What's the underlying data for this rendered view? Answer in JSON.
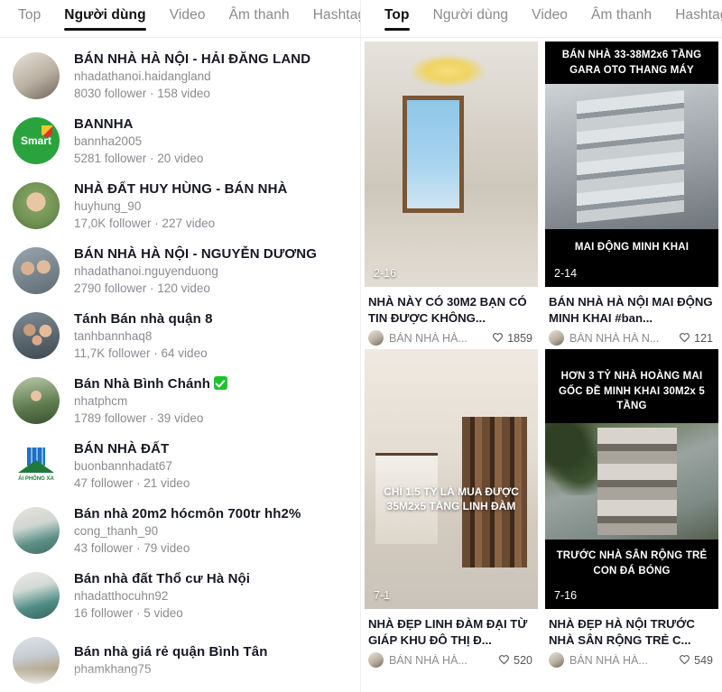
{
  "left_panel": {
    "tabs": [
      {
        "label": "Top",
        "active": false
      },
      {
        "label": "Người dùng",
        "active": true
      },
      {
        "label": "Video",
        "active": false
      },
      {
        "label": "Âm thanh",
        "active": false
      },
      {
        "label": "Hashtag",
        "active": false
      }
    ],
    "users": [
      {
        "name": "BÁN NHÀ HÀ NỘI - HẢI ĐĂNG LAND",
        "handle": "nhadathanoi.haidangland",
        "stats": "8030 follower · 158 video",
        "verified": false,
        "avatar": "room-interior-photo"
      },
      {
        "name": "BANNHA",
        "handle": "bannha2005",
        "stats": "5281 follower · 20 video",
        "verified": false,
        "avatar": "smart-green-logo"
      },
      {
        "name": "NHÀ ĐẤT HUY HÙNG - BÁN NHÀ",
        "handle": "huyhung_90",
        "stats": "17,0K follower · 227 video",
        "verified": false,
        "avatar": "man-with-cap-photo"
      },
      {
        "name": "BÁN NHÀ HÀ NỘI - NGUYỄN DƯƠNG",
        "handle": "nhadathanoi.nguyenduong",
        "stats": "2790 follower · 120 video",
        "verified": false,
        "avatar": "person-indoor-photo"
      },
      {
        "name": "Tánh Bán nhà quận 8",
        "handle": "tanhbannhaq8",
        "stats": "11,7K follower · 64 video",
        "verified": false,
        "avatar": "family-photo"
      },
      {
        "name": "Bán Nhà Bình Chánh",
        "handle": "nhatphcm",
        "stats": "1789 follower · 39 video",
        "verified": true,
        "avatar": "woman-outdoor-photo"
      },
      {
        "name": "BÁN NHÀ ĐẤT",
        "handle": "buonbannhadat67",
        "stats": "47 follower · 21 video",
        "verified": false,
        "avatar": "real-estate-logo"
      },
      {
        "name": "Bán nhà 20m2 hócmôn 700tr hh2%",
        "handle": "cong_thanh_90",
        "stats": "43 follower · 79 video",
        "verified": false,
        "avatar": "kitchen-photo"
      },
      {
        "name": "Bán nhà đất Thổ cư Hà Nội",
        "handle": "nhadatthocuhn92",
        "stats": "16 follower · 5 video",
        "verified": false,
        "avatar": "kitchen-green-photo"
      },
      {
        "name": "Bán nhà giá rẻ quận Bình Tân",
        "handle": "phamkhang75",
        "stats": "",
        "verified": false,
        "avatar": "bathroom-photo"
      }
    ]
  },
  "right_panel": {
    "tabs": [
      {
        "label": "Top",
        "active": true
      },
      {
        "label": "Người dùng",
        "active": false
      },
      {
        "label": "Video",
        "active": false
      },
      {
        "label": "Âm thanh",
        "active": false
      },
      {
        "label": "Hashtag",
        "active": false
      }
    ],
    "videos": [
      {
        "top_band": "",
        "bottom_band": "",
        "overlay_text": "",
        "duration": "2-16",
        "caption": "NHÀ NÀY CÓ 30M2 BẠN CÓ TIN ĐƯỢC KHÔNG...",
        "author": "BÁN NHÀ HÀ...",
        "likes": "1859",
        "thumb_style": "ph-hall",
        "avatar": "author-avatar"
      },
      {
        "top_band": "BÁN NHÀ 33-38M2x6 TẦNG GARA OTO THANG MÁY",
        "bottom_band": "MAI ĐỘNG MINH KHAI",
        "overlay_text": "",
        "duration": "2-14",
        "caption": "BÁN NHÀ HÀ NỘI MAI ĐỘNG MINH KHAI #ban...",
        "author": "BÁN NHÀ HÀ N...",
        "likes": "121",
        "thumb_style": "ph-bldg",
        "avatar": "author-avatar"
      },
      {
        "top_band": "",
        "bottom_band": "",
        "overlay_text": "CHỈ 1.5 TỶ LÀ MUA ĐƯỢC 35M2x5 TẦNG LINH ĐÀM",
        "duration": "7-1",
        "caption": "NHÀ ĐẸP LINH ĐÀM ĐẠI TỪ GIÁP KHU ĐÔ THỊ Đ...",
        "author": "BÁN NHÀ HÀ...",
        "likes": "520",
        "thumb_style": "ph-room",
        "avatar": "author-avatar"
      },
      {
        "top_band": "HƠN 3 TỶ NHÀ HOÀNG MAI GỐC ĐỀ MINH KHAI 30M2x 5 TẦNG",
        "bottom_band": "TRƯỚC NHÀ SÂN RỘNG TRẺ CON ĐÁ BÓNG",
        "overlay_text": "",
        "duration": "7-16",
        "caption": "NHÀ ĐẸP HÀ NỘI TRƯỚC NHÀ SÂN RỘNG TRẺ C...",
        "author": "BÁN NHÀ HÀ...",
        "likes": "549",
        "thumb_style": "ph-tree",
        "avatar": "author-avatar"
      }
    ]
  }
}
